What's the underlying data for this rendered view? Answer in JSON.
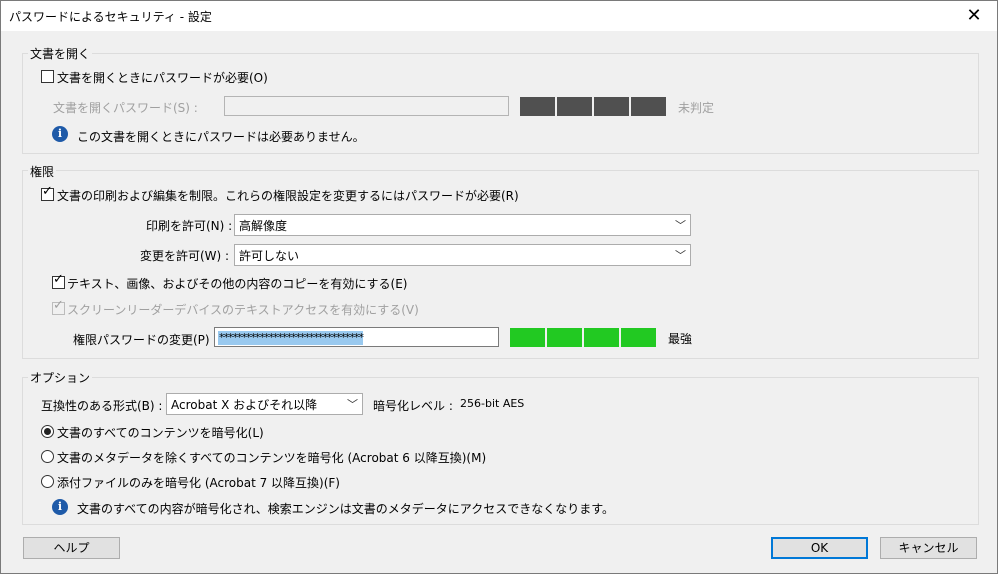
{
  "window": {
    "title": "パスワードによるセキュリティ - 設定",
    "close_glyph": "✕"
  },
  "open_doc": {
    "group_title": "文書を開く",
    "require_checkbox_label": "文書を開くときにパスワードが必要(O)",
    "require_checked": false,
    "password_label": "文書を開くパスワード(S) :",
    "password_value": "",
    "strength_text": "未判定",
    "strength_color": "#505050",
    "info_text": "この文書を開くときにパスワードは必要ありません。"
  },
  "permissions": {
    "group_title": "権限",
    "restrict_label": "文書の印刷および編集を制限。これらの権限設定を変更するにはパスワードが必要(R)",
    "restrict_checked": true,
    "print_label": "印刷を許可(N) :",
    "print_value": "高解像度",
    "change_label": "変更を許可(W) :",
    "change_value": "許可しない",
    "copy_label": "テキスト、画像、およびその他の内容のコピーを有効にする(E)",
    "copy_checked": true,
    "screenreader_label": "スクリーンリーダーデバイスのテキストアクセスを有効にする(V)",
    "screenreader_checked": true,
    "perm_password_label": "権限パスワードの変更(P) :",
    "perm_password_value": "********************************",
    "strength_text": "最強",
    "strength_color": "#22c922"
  },
  "options": {
    "group_title": "オプション",
    "compat_label": "互換性のある形式(B) :",
    "compat_value": "Acrobat X およびそれ以降",
    "encryption_level_label": "暗号化レベル :",
    "encryption_level_value": "256-bit AES",
    "radio_all": "文書のすべてのコンテンツを暗号化(L)",
    "radio_except_meta": "文書のメタデータを除くすべてのコンテンツを暗号化 (Acrobat 6 以降互換)(M)",
    "radio_attachments": "添付ファイルのみを暗号化 (Acrobat 7 以降互換)(F)",
    "selected_radio": "all",
    "info_text": "文書のすべての内容が暗号化され、検索エンジンは文書のメタデータにアクセスできなくなります。"
  },
  "buttons": {
    "help": "ヘルプ",
    "ok": "OK",
    "cancel": "キャンセル"
  },
  "icons": {
    "info": "info-icon",
    "chevron": "chevron-down-icon",
    "checkmark": "checkmark-icon"
  },
  "colors": {
    "accent": "#0078d7",
    "info_blue": "#1e5aa8",
    "selection": "#99c9ef"
  }
}
